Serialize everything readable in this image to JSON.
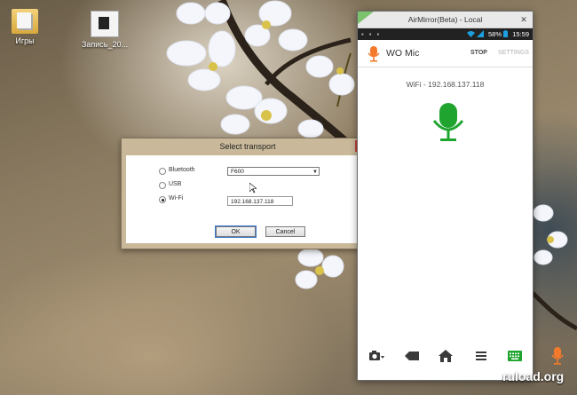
{
  "desktop": {
    "icons": [
      {
        "label": "Игры"
      },
      {
        "label": "Запись_20..."
      }
    ]
  },
  "dialog": {
    "title": "Select transport",
    "close_glyph": "✕",
    "options": [
      {
        "label": "Bluetooth",
        "selected": false
      },
      {
        "label": "USB",
        "selected": false
      },
      {
        "label": "Wi-Fi",
        "selected": true
      }
    ],
    "device_select": {
      "value": "F600",
      "arrow": "▼"
    },
    "ip_input": {
      "value": "192.168.137.118"
    },
    "ok_label": "OK",
    "cancel_label": "Cancel"
  },
  "phone": {
    "title": "AirMirror(Beta) - Local",
    "close_glyph": "✕",
    "status": {
      "left_icons": "▪ ▪ ▪",
      "battery": "58%",
      "time": "15:59"
    },
    "app_name": "WO Mic",
    "stop_label": "STOP",
    "settings_label": "SETTINGS",
    "wifi_text": "WiFi - 192.168.137.118",
    "colors": {
      "mic_green": "#1fa42f",
      "mic_orange": "#f47a2b",
      "wifi_icon": "#1ca0e0"
    }
  },
  "watermark": "ruload.org"
}
